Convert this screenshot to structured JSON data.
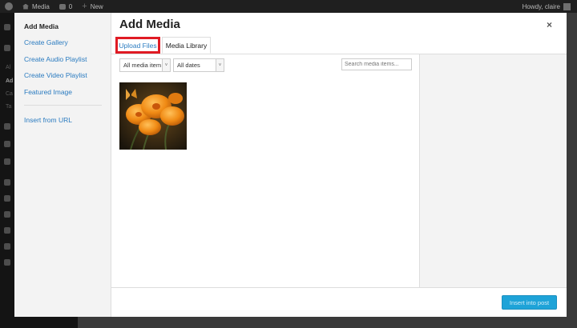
{
  "admin_bar": {
    "site_name": "Media",
    "comments_count": "0",
    "new_label": "New",
    "howdy_text": "Howdy, claire"
  },
  "admin_menu": {
    "partial_labels": [
      "Al",
      "Ad",
      "Ca",
      "Ta"
    ]
  },
  "media_modal": {
    "title": "Add Media",
    "close_symbol": "×",
    "menu": [
      {
        "label": "Add Media",
        "current": true
      },
      {
        "label": "Create Gallery"
      },
      {
        "label": "Create Audio Playlist"
      },
      {
        "label": "Create Video Playlist"
      },
      {
        "label": "Featured Image"
      },
      {
        "label": "Insert from URL"
      }
    ],
    "tabs": {
      "upload": "Upload Files",
      "library": "Media Library"
    },
    "filters": {
      "type_selected": "All media item",
      "date_selected": "All dates",
      "arrow": "˅"
    },
    "search": {
      "placeholder": "Search media items..."
    },
    "attachments": [
      {
        "kind": "image",
        "subject": "orange flowers with butterfly"
      }
    ],
    "insert_button": "Insert into post"
  },
  "colors": {
    "accent_link": "#2a7bc0",
    "highlight": "#e01b24",
    "primary_button": "#1ea3d8",
    "admin_bar": "#1f1f1f"
  }
}
